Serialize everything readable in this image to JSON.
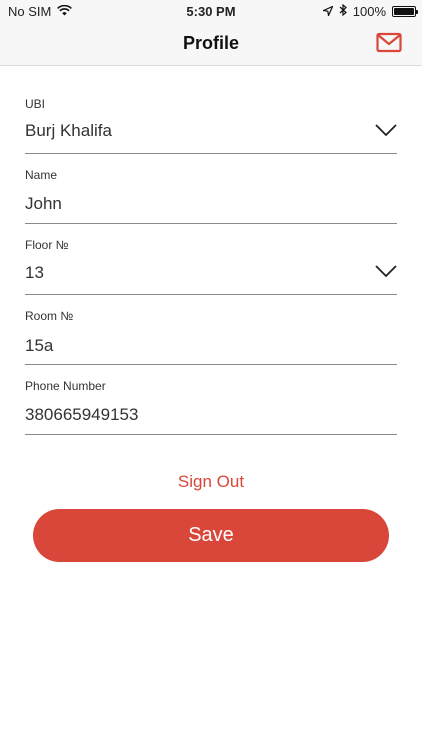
{
  "status_bar": {
    "carrier": "No SIM",
    "time": "5:30 PM",
    "battery": "100%",
    "icons": [
      "wifi-icon",
      "location-arrow-icon",
      "bluetooth-icon",
      "battery-icon"
    ]
  },
  "nav": {
    "title": "Profile",
    "mail_icon": "mail-icon"
  },
  "form": {
    "ubi": {
      "label": "UBI",
      "value": "Burj Khalifa"
    },
    "name": {
      "label": "Name",
      "value": "John"
    },
    "floor": {
      "label": "Floor №",
      "value": "13"
    },
    "room": {
      "label": "Room №",
      "value": "15a"
    },
    "phone": {
      "label": "Phone Number",
      "value": "380665949153"
    }
  },
  "actions": {
    "sign_out": "Sign Out",
    "save": "Save"
  },
  "colors": {
    "accent": "#d9463a",
    "nav_background": "#f7f7f7"
  }
}
